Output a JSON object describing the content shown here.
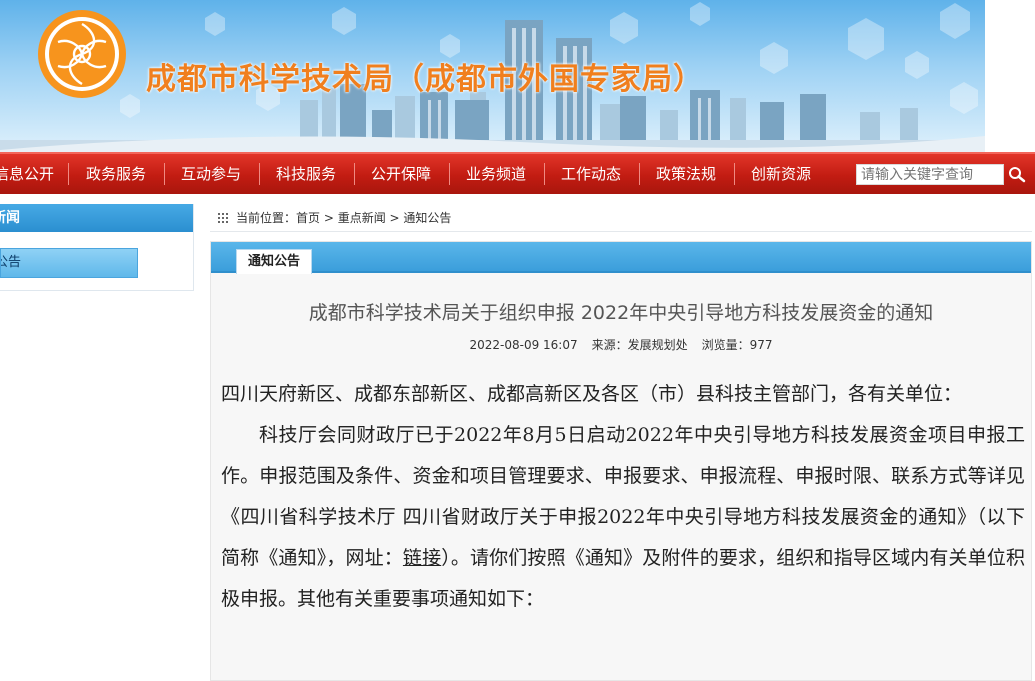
{
  "banner": {
    "site_title": "成都市科学技术局（成都市外国专家局）"
  },
  "nav": {
    "items": [
      {
        "label": "信息公开"
      },
      {
        "label": "政务服务"
      },
      {
        "label": "互动参与"
      },
      {
        "label": "科技服务"
      },
      {
        "label": "公开保障"
      },
      {
        "label": "业务频道"
      },
      {
        "label": "工作动态"
      },
      {
        "label": "政策法规"
      },
      {
        "label": "创新资源"
      }
    ],
    "search_placeholder": "请输入关键字查询",
    "search_icon": "magnifier-icon"
  },
  "sidebar": {
    "heading": "新闻",
    "item": "公告"
  },
  "breadcrumb": {
    "prefix": "当前位置：",
    "home": "首页",
    "sep": " > ",
    "level1": "重点新闻",
    "level2": "通知公告"
  },
  "panel": {
    "tab_label": "通知公告"
  },
  "article": {
    "title": "成都市科学技术局关于组织申报 2022年中央引导地方科技发展资金的通知",
    "date": "2022-08-09 16:07",
    "source": "来源：发展规划处",
    "views": "浏览量：977",
    "salutation": "四川天府新区、成都东部新区、成都高新区及各区（市）县科技主管部门，各有关单位：",
    "para1_before_link": "科技厅会同财政厅已于2022年8月5日启动2022年中央引导地方科技发展资金项目申报工作。申报范围及条件、资金和项目管理要求、申报要求、申报流程、申报时限、联系方式等详见《四川省科学技术厅 四川省财政厅关于申报2022年中央引导地方科技发展资金的通知》（以下简称《通知》，网址：",
    "link_text": "链接",
    "para1_after_link": "）。请你们按照《通知》及附件的要求，组织和指导区域内有关单位积极申报。其他有关重要事项通知如下："
  },
  "colors": {
    "nav_red": "#c21c12",
    "title_orange": "#f07f1e",
    "tab_blue": "#3b9edb"
  }
}
